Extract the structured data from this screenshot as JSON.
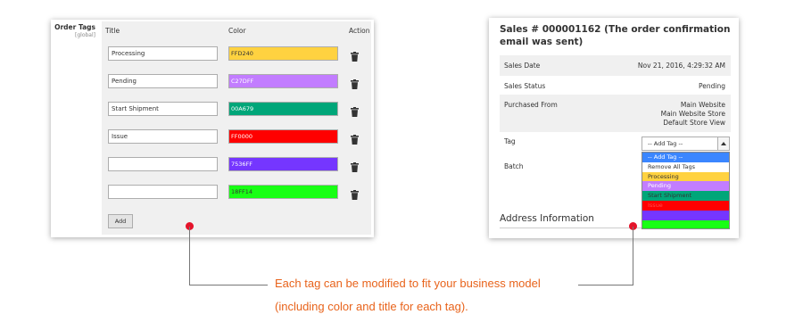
{
  "tags_config": {
    "section_label": "Order Tags",
    "scope_label": "[global]",
    "columns": {
      "title": "Title",
      "color": "Color",
      "action": "Action"
    },
    "rows": [
      {
        "title": "Processing",
        "color": "FFD240",
        "text_color": "#333333"
      },
      {
        "title": "Pending",
        "color": "C27DFF",
        "text_color": "#ffffff"
      },
      {
        "title": "Start Shipment",
        "color": "00A679",
        "text_color": "#ffffff"
      },
      {
        "title": "Issue",
        "color": "FF0000",
        "text_color": "#ffffff"
      },
      {
        "title": "",
        "color": "7536FF",
        "text_color": "#ffffff"
      },
      {
        "title": "",
        "color": "18FF14",
        "text_color": "#333333"
      }
    ],
    "add_button_label": "Add"
  },
  "order_view": {
    "title": "Sales # 000001162 (The order confirmation email was sent)",
    "sales_date_label": "Sales Date",
    "sales_date_value": "Nov 21, 2016, 4:29:32 AM",
    "sales_status_label": "Sales Status",
    "sales_status_value": "Pending",
    "purchased_from_label": "Purchased From",
    "purchased_from_lines": [
      "Main Website",
      "Main Website Store",
      "Default Store View"
    ],
    "tag_label": "Tag",
    "tag_select_value": "-- Add Tag --",
    "batch_label": "Batch",
    "address_title": "Address Information",
    "dropdown_options": [
      {
        "label": "-- Add Tag --",
        "bg": "#3b86ff",
        "fg": "#ffffff"
      },
      {
        "label": "Remove All Tags",
        "bg": "#ffffff",
        "fg": "#333333"
      },
      {
        "label": "Processing",
        "bg": "#FFD240",
        "fg": "#333333"
      },
      {
        "label": "Pending",
        "bg": "#C27DFF",
        "fg": "#ffffff"
      },
      {
        "label": "Start Shipment",
        "bg": "#00A679",
        "fg": "#333333"
      },
      {
        "label": "Issue",
        "bg": "#FF0000",
        "fg": "#ff4d4d"
      },
      {
        "label": "",
        "bg": "#7536FF",
        "fg": "#ffffff"
      },
      {
        "label": "",
        "bg": "#18FF14",
        "fg": "#333333"
      }
    ]
  },
  "caption": {
    "line1": "Each tag can be modified to fit your business model",
    "line2": "(including color and title for each tag)."
  }
}
